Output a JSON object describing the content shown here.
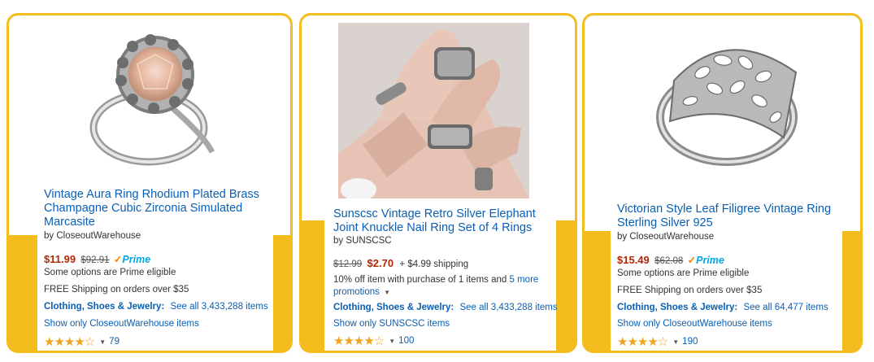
{
  "colors": {
    "accent": "#f3bd1e",
    "link": "#0a5fb4",
    "price": "#b12704",
    "star": "#f0a41c"
  },
  "cards": [
    {
      "title": "Vintage Aura Ring Rhodium Plated Brass Champagne Cubic Zirconia Simulated Marcasite",
      "by": "by CloseoutWarehouse",
      "price": "$11.99",
      "list_price": "$92.91",
      "prime": "Prime",
      "prime_note": "Some options are Prime eligible",
      "shipping": "FREE Shipping on orders over $35",
      "category": "Clothing, Shoes & Jewelry:",
      "see_all": "See all 3,433,288 items",
      "show_only": "Show only CloseoutWarehouse items",
      "stars": "★★★★☆",
      "rating_value": 4.5,
      "reviews": "79",
      "image_icon": "ring-champagne-stone-icon"
    },
    {
      "title": "Sunscsc Vintage Retro Silver Elephant Joint Knuckle Nail Ring Set of 4 Rings",
      "by": "by SUNSCSC",
      "list_price": "$12.99",
      "price": "$2.70",
      "shipping_extra": "+ $4.99 shipping",
      "promo": "10% off item with purchase of 1 items and",
      "promo_link": "5 more promotions",
      "category": "Clothing, Shoes & Jewelry:",
      "see_all": "See all 3,433,288 items",
      "show_only": "Show only SUNSCSC items",
      "stars": "★★★★☆",
      "rating_value": 4.5,
      "reviews": "100",
      "image_icon": "hand-with-rings-icon"
    },
    {
      "title": "Victorian Style Leaf Filigree Vintage Ring Sterling Silver 925",
      "by": "by CloseoutWarehouse",
      "price": "$15.49",
      "list_price": "$62.08",
      "prime": "Prime",
      "prime_note": "Some options are Prime eligible",
      "shipping": "FREE Shipping on orders over $35",
      "category": "Clothing, Shoes & Jewelry:",
      "see_all": "See all 64,477 items",
      "show_only": "Show only CloseoutWarehouse items",
      "stars": "★★★★☆",
      "rating_value": 4.5,
      "reviews": "190",
      "image_icon": "filigree-ring-icon"
    }
  ]
}
